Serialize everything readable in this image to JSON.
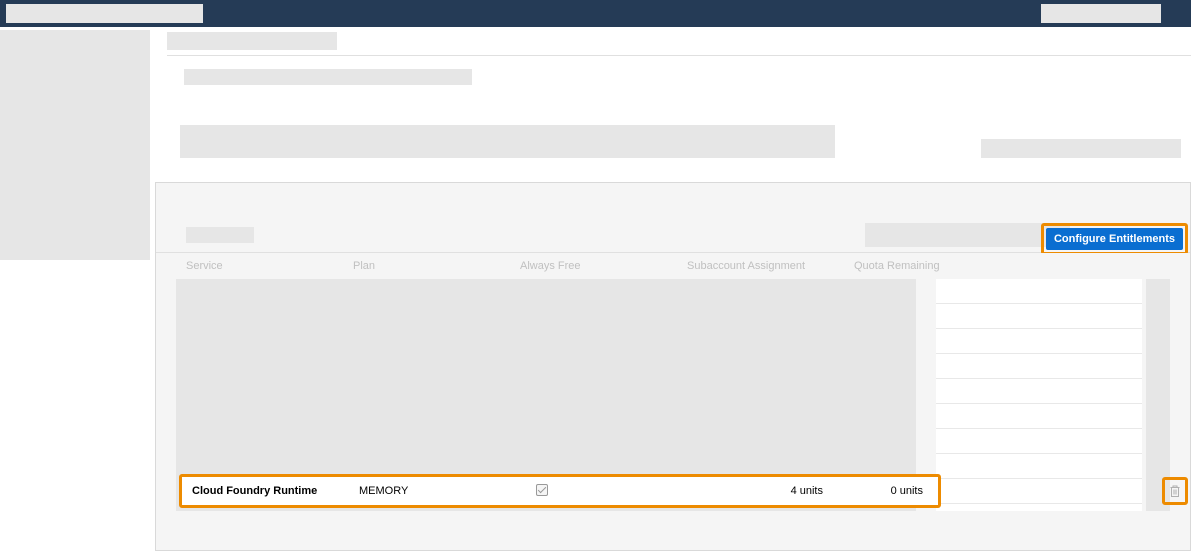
{
  "header": {
    "configure_label": "Configure Entitlements"
  },
  "table": {
    "columns": {
      "service": "Service",
      "plan": "Plan",
      "always_free": "Always Free",
      "assignment": "Subaccount Assignment",
      "remaining": "Quota Remaining"
    },
    "row": {
      "service": "Cloud Foundry Runtime",
      "plan": "MEMORY",
      "checked": true,
      "assignment": "4 units",
      "remaining": "0 units"
    }
  },
  "icons": {
    "trash": "trash-icon"
  }
}
